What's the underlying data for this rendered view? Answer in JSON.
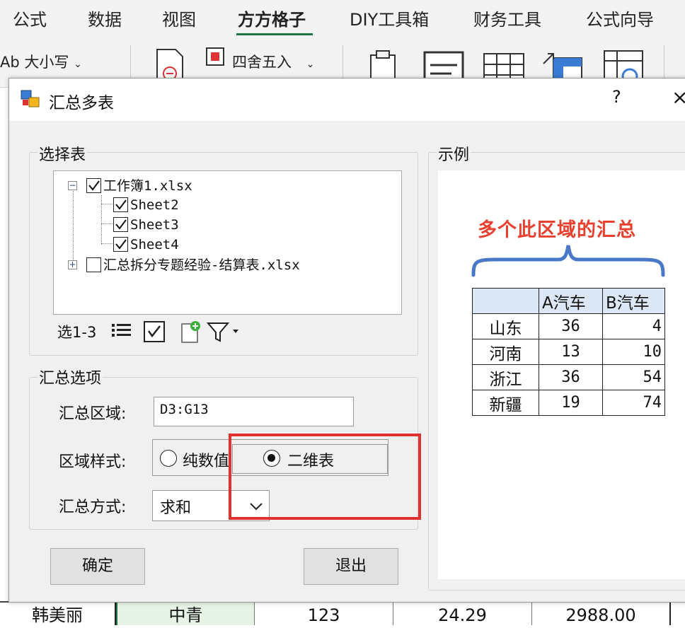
{
  "ribbon": {
    "tabs": [
      {
        "label": "公式"
      },
      {
        "label": "数据"
      },
      {
        "label": "视图"
      },
      {
        "label": "方方格子"
      },
      {
        "label": "DIY工具箱"
      },
      {
        "label": "财务工具"
      },
      {
        "label": "公式向导"
      }
    ],
    "active_tab": "方方格子",
    "case_button": "Ab 大小写",
    "round_button": "四舍五入",
    "accent_color": "#217346"
  },
  "dialog": {
    "title": "汇总多表",
    "help": "?",
    "close": "×",
    "select_group": {
      "legend": "选择表",
      "tree": [
        {
          "label": "工作簿1.xlsx",
          "checked": true,
          "expanded": true,
          "children": [
            {
              "label": "Sheet2",
              "checked": true
            },
            {
              "label": "Sheet3",
              "checked": true
            },
            {
              "label": "Sheet4",
              "checked": true
            }
          ]
        },
        {
          "label": "汇总拆分专题经验-结算表.xlsx",
          "checked": false,
          "expanded": false
        }
      ],
      "toolbar_text": "选1-3",
      "toolbar_icons": [
        "list-icon",
        "check-all-icon",
        "add-file-icon",
        "filter-icon"
      ]
    },
    "options_group": {
      "legend": "汇总选项",
      "range_label": "汇总区域:",
      "range_value": "D3:G13",
      "style_label": "区域样式:",
      "style_options": [
        {
          "label": "纯数值",
          "selected": false
        },
        {
          "label": "二维表",
          "selected": true
        }
      ],
      "method_label": "汇总方式:",
      "method_value": "求和"
    },
    "ok_button": "确定",
    "exit_button": "退出",
    "example": {
      "legend": "示例",
      "heading": "多个此区域的汇总",
      "heading_color": "#e8402f",
      "table": {
        "columns": [
          "",
          "A汽车",
          "B汽车"
        ],
        "rows": [
          {
            "name": "山东",
            "a": "36",
            "b": "4"
          },
          {
            "name": "河南",
            "a": "13",
            "b": "10"
          },
          {
            "name": "浙江",
            "a": "36",
            "b": "54"
          },
          {
            "name": "新疆",
            "a": "19",
            "b": "74"
          }
        ]
      }
    }
  },
  "sheet_row": [
    "韩美丽",
    "中青",
    "123",
    "24.29",
    "2988.00"
  ]
}
